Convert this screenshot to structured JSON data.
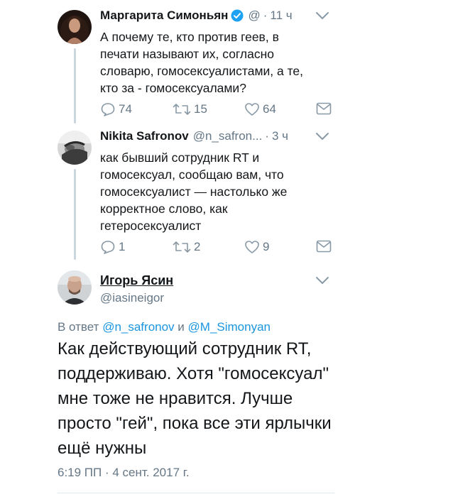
{
  "tweet1": {
    "name": "Маргарита Симоньян",
    "handle": "@",
    "time": "11 ч",
    "text": "А почему те, кто против геев, в\nпечати называют их, согласно\nсловарю, гомосексуалистами, а те,\nкто за - гомосексуалами?",
    "replies": "74",
    "retweets": "15",
    "likes": "64"
  },
  "tweet2": {
    "name": "Nikita Safronov",
    "handle": "@n_safron...",
    "time": "3 ч",
    "text": "как бывший сотрудник RT и\nгомосексуал, сообщаю вам, что\nгомосексуалист — настолько же\nкорректное слово, как\nгетеросексуалист",
    "replies": "1",
    "retweets": "2",
    "likes": "9"
  },
  "tweet3": {
    "name": "Игорь Ясин",
    "handle": "@iasineigor",
    "reply_prefix": "В ответ",
    "reply_user1": "@n_safronov",
    "reply_and": "и",
    "reply_user2": "@M_Simonyan",
    "text": "Как действующий сотрудник RT,\nподдерживаю. Хотя \"гомосексуал\"\nмне тоже не нравится. Лучше\nпросто \"гей\", пока все эти ярлычки\nещё нужны",
    "timestamp": "6:19 ПП · 4 сент. 2017 г."
  },
  "dot_separator": "·",
  "colors": {
    "accent": "#1b95e0",
    "muted": "#657786",
    "text": "#14171a",
    "verified": "#1da1f2"
  }
}
